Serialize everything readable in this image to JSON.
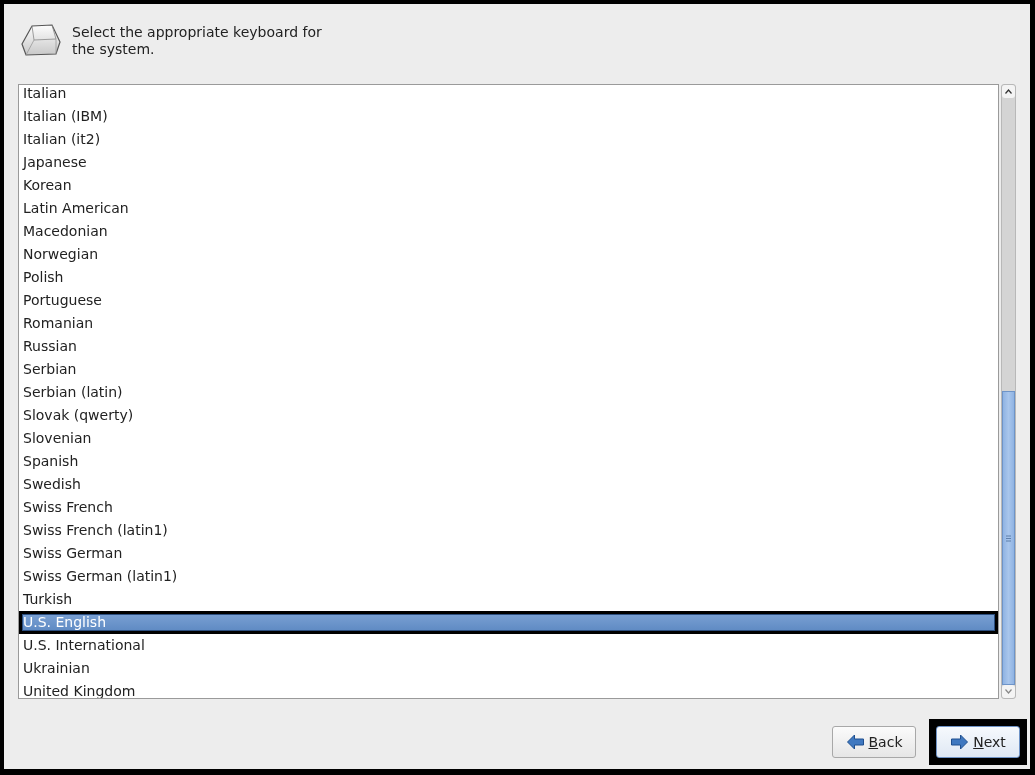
{
  "header": {
    "text": "Select the appropriate keyboard for the system."
  },
  "keyboards": [
    {
      "label": "Italian",
      "selected": false
    },
    {
      "label": "Italian (IBM)",
      "selected": false
    },
    {
      "label": "Italian (it2)",
      "selected": false
    },
    {
      "label": "Japanese",
      "selected": false
    },
    {
      "label": "Korean",
      "selected": false
    },
    {
      "label": "Latin American",
      "selected": false
    },
    {
      "label": "Macedonian",
      "selected": false
    },
    {
      "label": "Norwegian",
      "selected": false
    },
    {
      "label": "Polish",
      "selected": false
    },
    {
      "label": "Portuguese",
      "selected": false
    },
    {
      "label": "Romanian",
      "selected": false
    },
    {
      "label": "Russian",
      "selected": false
    },
    {
      "label": "Serbian",
      "selected": false
    },
    {
      "label": "Serbian (latin)",
      "selected": false
    },
    {
      "label": "Slovak (qwerty)",
      "selected": false
    },
    {
      "label": "Slovenian",
      "selected": false
    },
    {
      "label": "Spanish",
      "selected": false
    },
    {
      "label": "Swedish",
      "selected": false
    },
    {
      "label": "Swiss French",
      "selected": false
    },
    {
      "label": "Swiss French (latin1)",
      "selected": false
    },
    {
      "label": "Swiss German",
      "selected": false
    },
    {
      "label": "Swiss German (latin1)",
      "selected": false
    },
    {
      "label": "Turkish",
      "selected": false
    },
    {
      "label": "U.S. English",
      "selected": true
    },
    {
      "label": "U.S. International",
      "selected": false
    },
    {
      "label": "Ukrainian",
      "selected": false
    },
    {
      "label": "United Kingdom",
      "selected": false
    }
  ],
  "buttons": [
    {
      "kind": "back",
      "label": "Back",
      "mnemonic": true,
      "focused": false
    },
    {
      "kind": "next",
      "label": "Next",
      "mnemonic": true,
      "focused": true
    }
  ]
}
